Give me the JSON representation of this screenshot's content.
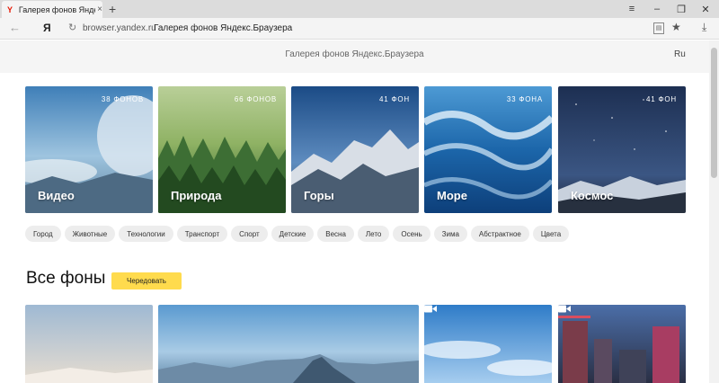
{
  "browser": {
    "tab_title": "Галерея фонов Яндекс.Б",
    "tab_favicon": "Y",
    "tab_close": "×",
    "new_tab": "+",
    "window_controls": [
      "≡",
      "–",
      "❐",
      "✕"
    ],
    "back_glyph": "←",
    "logo": "Я",
    "refresh_glyph": "↻",
    "url": "browser.yandex.ru",
    "page_title": "Галерея фонов Яндекс.Браузера",
    "bookmark_glyph": "★",
    "download_glyph": "⤓"
  },
  "header": {
    "title": "Галерея фонов Яндекс.Браузера",
    "lang": "Ru"
  },
  "categories": [
    {
      "name": "Видео",
      "count": "38 ФОНОВ"
    },
    {
      "name": "Природа",
      "count": "66 ФОНОВ"
    },
    {
      "name": "Горы",
      "count": "41 ФОН"
    },
    {
      "name": "Море",
      "count": "33 ФОНА"
    },
    {
      "name": "Космос",
      "count": "41 ФОН"
    }
  ],
  "tags": [
    "Город",
    "Животные",
    "Технологии",
    "Транспорт",
    "Спорт",
    "Детские",
    "Весна",
    "Лето",
    "Осень",
    "Зима",
    "Абстрактное",
    "Цвета"
  ],
  "all": {
    "title": "Все фоны",
    "shuffle_label": "Чередовать"
  },
  "colors": {
    "accent_yellow": "#ffdb4d",
    "yandex_red": "#e61400"
  }
}
